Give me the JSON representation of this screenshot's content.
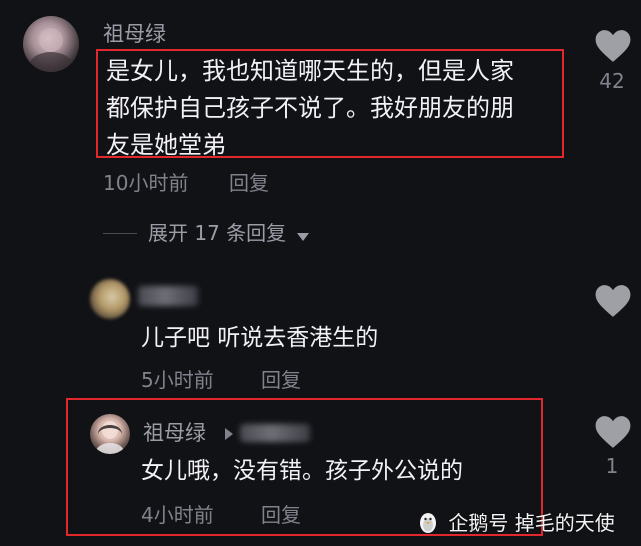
{
  "comments": [
    {
      "author": "祖母绿",
      "text": "是女儿，我也知道哪天生的，但是人家\n都保护自己孩子不说了。我好朋友的朋\n友是她堂弟",
      "time": "10小时前",
      "reply_label": "回复",
      "likes": "42"
    }
  ],
  "expand_replies": {
    "label": "展开 17 条回复"
  },
  "replies": [
    {
      "text": "儿子吧 听说去香港生的",
      "time": "5小时前",
      "reply_label": "回复"
    },
    {
      "author": "祖母绿",
      "text": "女儿哦，没有错。孩子外公说的",
      "time": "4小时前",
      "reply_label": "回复",
      "likes": "1"
    }
  ],
  "watermark": {
    "text": "企鹅号 掉毛的天使"
  },
  "colors": {
    "background": "#111216",
    "highlight_box": "#e2282d",
    "meta_text": "#80828c",
    "body_text": "#f1f1f6"
  }
}
